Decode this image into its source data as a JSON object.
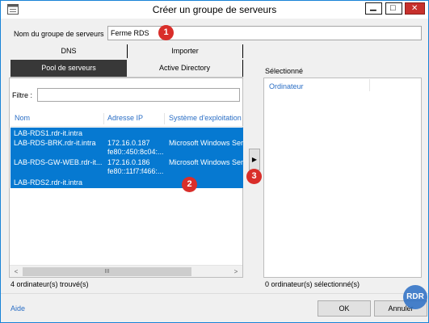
{
  "window": {
    "title": "Créer un groupe de serveurs",
    "minimize_glyph": "▁",
    "maximize_glyph": "□",
    "close_glyph": "✕"
  },
  "group_name": {
    "label": "Nom du groupe de serveurs",
    "value": "Ferme RDS"
  },
  "tabs": {
    "dns": "DNS",
    "importer": "Importer",
    "pool": "Pool de serveurs",
    "active_directory": "Active Directory"
  },
  "filter": {
    "label": "Filtre :",
    "value": ""
  },
  "table": {
    "columns": [
      "Nom",
      "Adresse IP",
      "Système d'exploitation"
    ],
    "rows": [
      {
        "name": "LAB-RDS1.rdr-it.intra",
        "ip1": "",
        "ip2": "",
        "os": ""
      },
      {
        "name": "LAB-RDS-BRK.rdr-it.intra",
        "ip1": "172.16.0.187",
        "ip2": "fe80::450:8c04:...",
        "os": "Microsoft Windows Ser"
      },
      {
        "name": "LAB-RDS-GW-WEB.rdr-it...",
        "ip1": "172.16.0.186",
        "ip2": "fe80::11f7:f466:...",
        "os": "Microsoft Windows Ser"
      },
      {
        "name": "LAB-RDS2.rdr-it.intra",
        "ip1": "",
        "ip2": "",
        "os": ""
      }
    ]
  },
  "scroll": {
    "left": "<",
    "right": ">",
    "thumb": "III"
  },
  "found_count": "4 ordinateur(s) trouvé(s)",
  "move_button": "▶",
  "selected": {
    "label": "Sélectionné",
    "column": "Ordinateur",
    "count": "0 ordinateur(s) sélectionné(s)"
  },
  "footer": {
    "help": "Aide",
    "ok": "OK",
    "cancel": "Annuler"
  },
  "markers": [
    "1",
    "2",
    "3"
  ],
  "logo_text": "RDR",
  "colors": {
    "selection": "#0679d1",
    "marker": "#d92e2a",
    "link": "#2a6ec5",
    "close": "#c7302c"
  }
}
